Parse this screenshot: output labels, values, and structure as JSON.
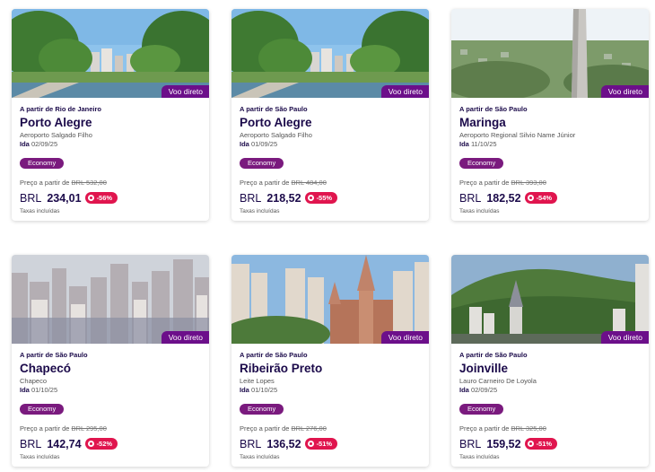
{
  "cards": [
    {
      "badge": "Voo direto",
      "origin": "A partir de Rio de Janeiro",
      "city": "Porto Alegre",
      "airport": "Aeroporto Salgado Filho",
      "date_label": "Ida",
      "date": "02/09/25",
      "cabin": "Economy",
      "from_label": "Preço a partir de",
      "old_price": "BRL  532,00",
      "currency": "BRL",
      "price": "234,01",
      "discount": "-56%",
      "taxes": "Taxas incluídas",
      "scene": "park"
    },
    {
      "badge": "Voo direto",
      "origin": "A partir de São Paulo",
      "city": "Porto Alegre",
      "airport": "Aeroporto Salgado Filho",
      "date_label": "Ida",
      "date": "01/09/25",
      "cabin": "Economy",
      "from_label": "Preço a partir de",
      "old_price": "BRL  484,00",
      "currency": "BRL",
      "price": "218,52",
      "discount": "-55%",
      "taxes": "Taxas incluídas",
      "scene": "park"
    },
    {
      "badge": "Voo direto",
      "origin": "A partir de São Paulo",
      "city": "Maringa",
      "airport": "Aeroporto Regional Silvio Name Júnior",
      "date_label": "Ida",
      "date": "11/10/25",
      "cabin": "Economy",
      "from_label": "Preço a partir de",
      "old_price": "BRL  393,00",
      "currency": "BRL",
      "price": "182,52",
      "discount": "-54%",
      "taxes": "Taxas incluídas",
      "scene": "tower"
    },
    {
      "badge": "Voo direto",
      "origin": "A partir de São Paulo",
      "city": "Chapecó",
      "airport": "Chapeco",
      "date_label": "Ida",
      "date": "01/10/25",
      "cabin": "Economy",
      "from_label": "Preço a partir de",
      "old_price": "BRL  295,00",
      "currency": "BRL",
      "price": "142,74",
      "discount": "-52%",
      "taxes": "Taxas incluídas",
      "scene": "city"
    },
    {
      "badge": "Voo direto",
      "origin": "A partir de São Paulo",
      "city": "Ribeirão Preto",
      "airport": "Leite Lopes",
      "date_label": "Ida",
      "date": "01/10/25",
      "cabin": "Economy",
      "from_label": "Preço a partir de",
      "old_price": "BRL  276,00",
      "currency": "BRL",
      "price": "136,52",
      "discount": "-51%",
      "taxes": "Taxas incluídas",
      "scene": "church"
    },
    {
      "badge": "Voo direto",
      "origin": "A partir de São Paulo",
      "city": "Joinville",
      "airport": "Lauro Carneiro De Loyola",
      "date_label": "Ida",
      "date": "02/09/25",
      "cabin": "Economy",
      "from_label": "Preço a partir de",
      "old_price": "BRL  325,00",
      "currency": "BRL",
      "price": "159,52",
      "discount": "-51%",
      "taxes": "Taxas incluídas",
      "scene": "hills"
    }
  ]
}
